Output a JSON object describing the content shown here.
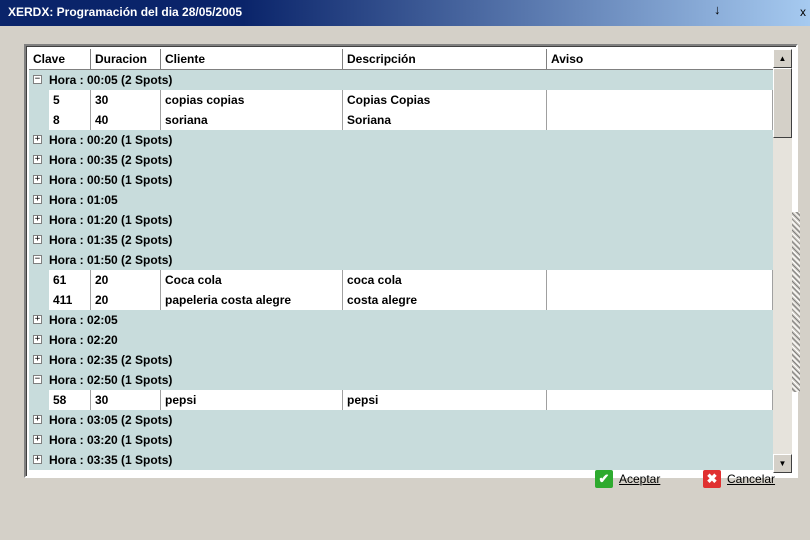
{
  "window": {
    "title": "XERDX: Programación del dia 28/05/2005",
    "close_glyph": "x",
    "cursor_glyph": "↓"
  },
  "columns": [
    "Clave",
    "Duracion",
    "Cliente",
    "Descripción",
    "Aviso"
  ],
  "rows": [
    {
      "type": "group",
      "expanded": true,
      "label": "Hora : 00:05 (2 Spots)"
    },
    {
      "type": "data",
      "clave": "5",
      "duracion": "30",
      "cliente": "copias copias",
      "descripcion": "Copias Copias",
      "aviso": ""
    },
    {
      "type": "data",
      "clave": "8",
      "duracion": "40",
      "cliente": "soriana",
      "descripcion": "Soriana",
      "aviso": ""
    },
    {
      "type": "group",
      "expanded": false,
      "label": "Hora : 00:20 (1 Spots)"
    },
    {
      "type": "group",
      "expanded": false,
      "label": "Hora : 00:35 (2 Spots)"
    },
    {
      "type": "group",
      "expanded": false,
      "label": "Hora : 00:50 (1 Spots)"
    },
    {
      "type": "group",
      "expanded": false,
      "label": "Hora : 01:05"
    },
    {
      "type": "group",
      "expanded": false,
      "label": "Hora : 01:20 (1 Spots)"
    },
    {
      "type": "group",
      "expanded": false,
      "label": "Hora : 01:35 (2 Spots)"
    },
    {
      "type": "group",
      "expanded": true,
      "label": "Hora : 01:50 (2 Spots)"
    },
    {
      "type": "data",
      "clave": "61",
      "duracion": "20",
      "cliente": "Coca cola",
      "descripcion": "coca cola",
      "aviso": ""
    },
    {
      "type": "data",
      "clave": "411",
      "duracion": "20",
      "cliente": "papeleria costa alegre",
      "descripcion": "costa alegre",
      "aviso": ""
    },
    {
      "type": "group",
      "expanded": false,
      "label": "Hora : 02:05"
    },
    {
      "type": "group",
      "expanded": false,
      "label": "Hora : 02:20"
    },
    {
      "type": "group",
      "expanded": false,
      "label": "Hora : 02:35 (2 Spots)"
    },
    {
      "type": "group",
      "expanded": true,
      "label": "Hora : 02:50 (1 Spots)"
    },
    {
      "type": "data",
      "clave": "58",
      "duracion": "30",
      "cliente": "pepsi",
      "descripcion": "pepsi",
      "aviso": ""
    },
    {
      "type": "group",
      "expanded": false,
      "label": "Hora : 03:05 (2 Spots)"
    },
    {
      "type": "group",
      "expanded": false,
      "label": "Hora : 03:20 (1 Spots)"
    },
    {
      "type": "group",
      "expanded": false,
      "label": "Hora : 03:35 (1 Spots)"
    }
  ],
  "toggle_glyphs": {
    "expanded": "−",
    "collapsed": "+"
  },
  "scroll_glyphs": {
    "up": "▲",
    "down": "▼"
  },
  "buttons": {
    "accept": {
      "label": "Aceptar",
      "icon": "checkmark-icon",
      "glyph": "✔",
      "color": "#2eaa2e"
    },
    "cancel": {
      "label": "Cancelar",
      "icon": "x-icon",
      "glyph": "✖",
      "color": "#e03030"
    }
  },
  "colors": {
    "group_row_bg": "#c8dcdc",
    "title_bar": "#0a246a"
  }
}
